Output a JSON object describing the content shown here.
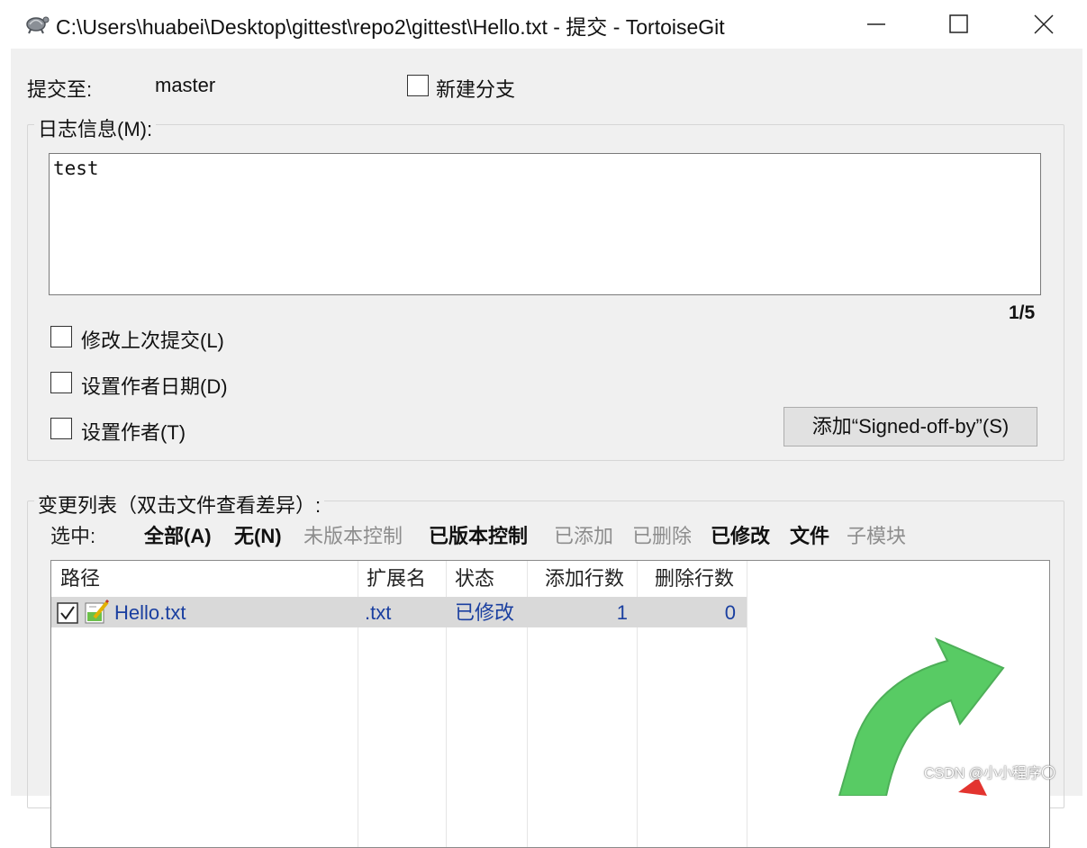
{
  "window": {
    "title": "C:\\Users\\huabei\\Desktop\\gittest\\repo2\\gittest\\Hello.txt - 提交 - TortoiseGit",
    "app_icon": "tortoise-icon"
  },
  "commit_to": {
    "label": "提交至:",
    "branch": "master",
    "new_branch_label": "新建分支",
    "new_branch_checked": false
  },
  "log_message": {
    "group_label": "日志信息(M):",
    "text": "test",
    "counter": "1/5"
  },
  "options": {
    "amend_label": "修改上次提交(L)",
    "set_date_label": "设置作者日期(D)",
    "set_author_label": "设置作者(T)",
    "signoff_button": "添加“Signed-off-by”(S)"
  },
  "changes": {
    "group_label": "变更列表（双击文件查看差异）:",
    "select_label": "选中:",
    "filters": [
      {
        "label": "全部(A)",
        "enabled": true
      },
      {
        "label": "无(N)",
        "enabled": true
      },
      {
        "label": "未版本控制",
        "enabled": false
      },
      {
        "label": "已版本控制",
        "enabled": true
      },
      {
        "label": "已添加",
        "enabled": false
      },
      {
        "label": "已删除",
        "enabled": false
      },
      {
        "label": "已修改",
        "enabled": true
      },
      {
        "label": "文件",
        "enabled": true
      },
      {
        "label": "子模块",
        "enabled": false
      }
    ],
    "columns": [
      "路径",
      "扩展名",
      "状态",
      "添加行数",
      "删除行数"
    ],
    "rows": [
      {
        "checked": true,
        "path": "Hello.txt",
        "ext": ".txt",
        "status": "已修改",
        "added": "1",
        "deleted": "0"
      }
    ]
  },
  "watermark": "CSDN @小小程序〇",
  "colors": {
    "link_blue": "#1a3fa0",
    "dialog_bg": "#f0f0f0",
    "arrow_green": "#3cc24a",
    "arrow_red": "#e3342f"
  }
}
